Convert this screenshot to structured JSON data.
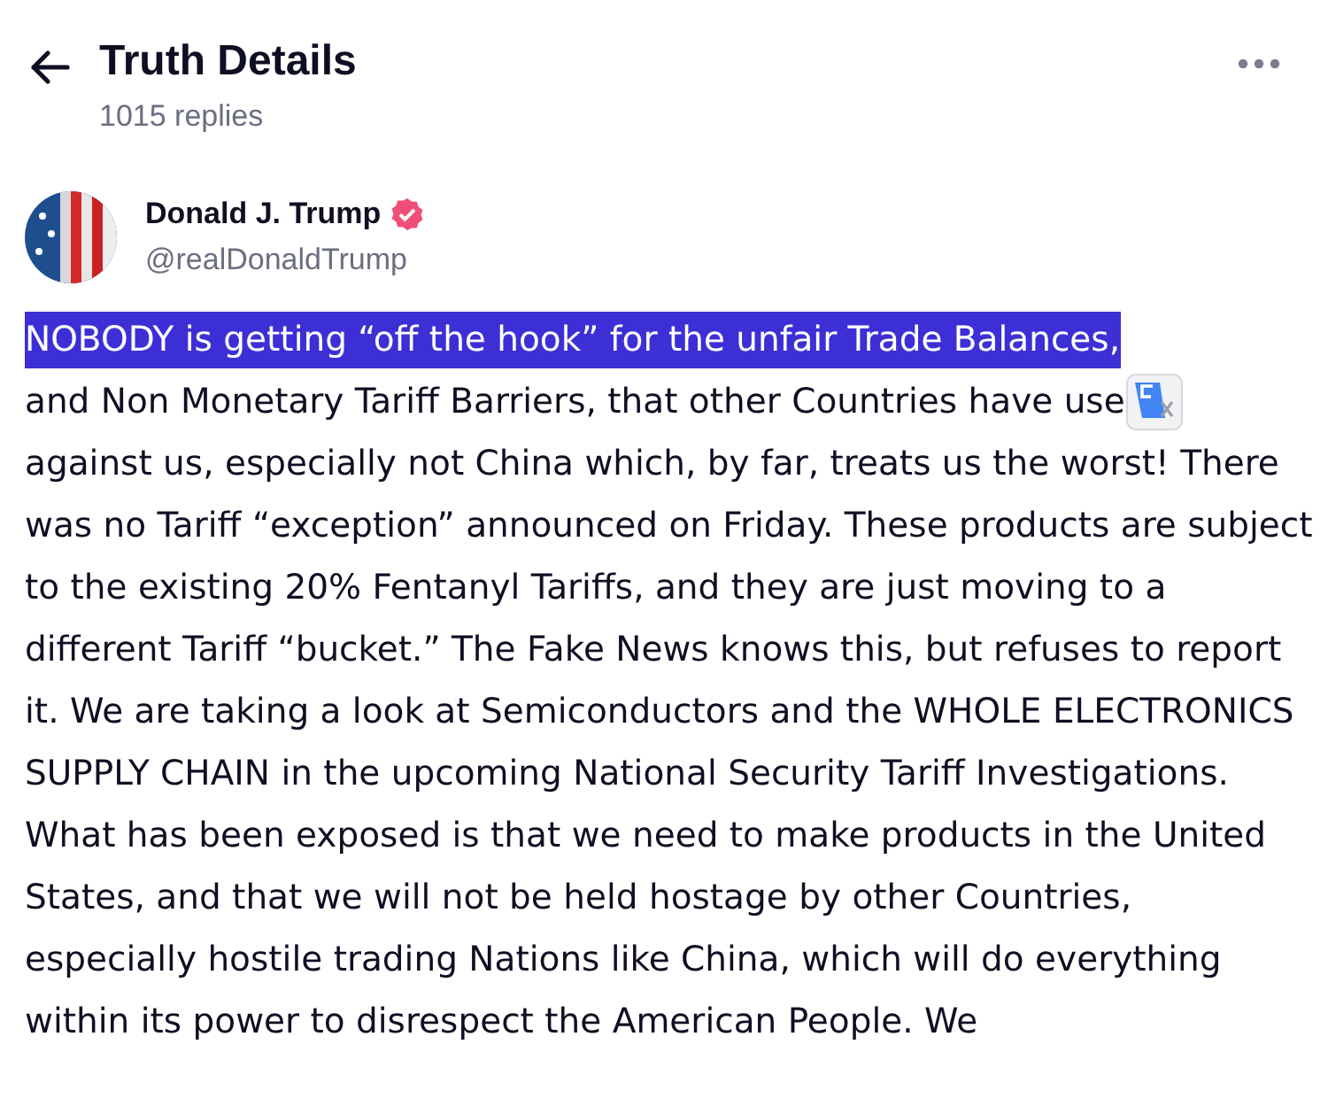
{
  "header": {
    "title": "Truth Details",
    "subtitle": "1015 replies"
  },
  "post": {
    "author": {
      "name": "Donald J. Trump",
      "verified": true,
      "handle": "@realDonaldTrump"
    },
    "selected_text": "NOBODY is getting “off the hook” for the unfair Trade Balances,",
    "second_line": "and Non Monetary Tariff Barriers, that other Countries have use",
    "text": "against us, especially not China which, by far, treats us the worst! There was no Tariff “exception” announced on Friday. These products are subject to the existing 20% Fentanyl Tariffs, and they are just moving to a different Tariff “bucket.” The Fake News knows this, but refuses to report it. We are taking a look at Semiconductors and the WHOLE ELECTRONICS SUPPLY CHAIN in the upcoming National Security Tariff Investigations. What has been exposed is that we need to make products in the United States, and that we will not be held hostage by other Countries, especially hostile trading Nations like China, which will do everything within its power to disrespect the American People. We"
  }
}
